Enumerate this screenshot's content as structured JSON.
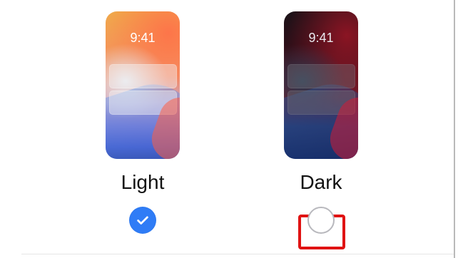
{
  "appearance": {
    "options": [
      {
        "label": "Light",
        "time": "9:41",
        "state": "selected",
        "theme": "light",
        "check_icon": "checkmark-circle-icon"
      },
      {
        "label": "Dark",
        "time": "9:41",
        "state": "unselected",
        "theme": "dark",
        "radio_icon": "empty-radio-icon"
      }
    ],
    "colors": {
      "selected_blue": "#2f7cf6",
      "highlight_red": "#e01313",
      "label_text": "#111111"
    }
  }
}
